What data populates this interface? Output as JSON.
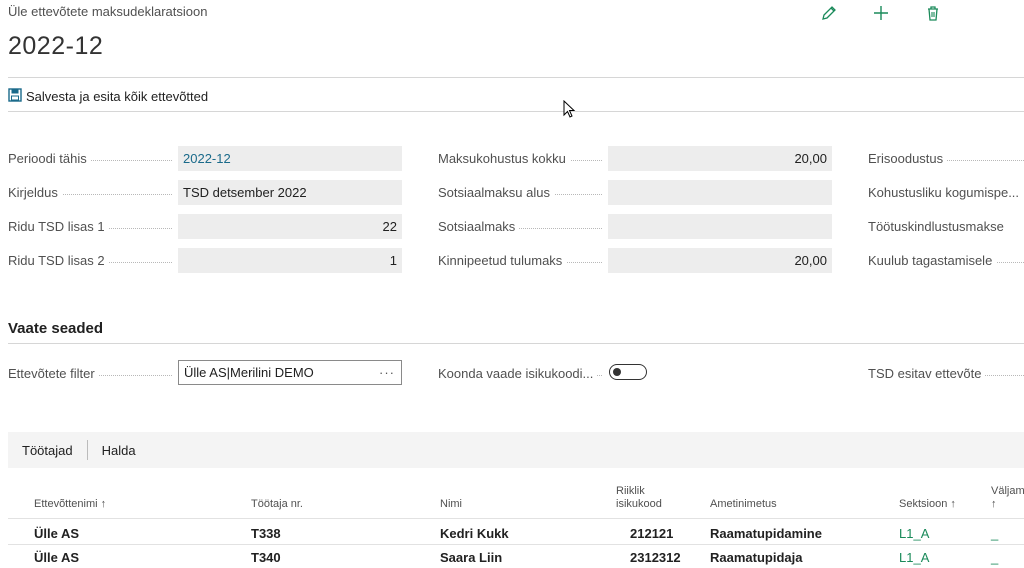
{
  "header": {
    "breadcrumb": "Üle ettevõtete maksudeklaratsioon",
    "title": "2022-12",
    "actions": [
      "edit-icon",
      "add-icon",
      "delete-icon"
    ]
  },
  "action_bar": {
    "save_label": "Salvesta ja esita kõik ettevõtted"
  },
  "fields": {
    "perioodi_tahis": {
      "label": "Perioodi tähis",
      "value": "2022-12"
    },
    "kirjeldus": {
      "label": "Kirjeldus",
      "value": "TSD detsember 2022"
    },
    "ridu_lisa1": {
      "label": "Ridu TSD lisas 1",
      "value": "22"
    },
    "ridu_lisa2": {
      "label": "Ridu TSD lisas 2",
      "value": "1"
    },
    "maksukohustus": {
      "label": "Maksukohustus kokku",
      "value": "20,00"
    },
    "sotsiaalmaksu_alus": {
      "label": "Sotsiaalmaksu alus",
      "value": ""
    },
    "sotsiaalmaks": {
      "label": "Sotsiaalmaks",
      "value": ""
    },
    "kinnipeetud": {
      "label": "Kinnipeetud tulumaks",
      "value": "20,00"
    },
    "erisoodustus": {
      "label": "Erisoodustus"
    },
    "kohustusliku": {
      "label": "Kohustusliku kogumispe..."
    },
    "tootuskindlustus": {
      "label": "Töötuskindlustusmakse"
    },
    "kuulub": {
      "label": "Kuulub tagastamisele"
    }
  },
  "view_settings": {
    "title": "Vaate seaded",
    "company_filter_label": "Ettevõtete filter",
    "company_filter_value": "Ülle AS|Merilini DEMO",
    "more_glyph": "···",
    "consolidate_label": "Koonda vaade isikukoodi...",
    "consolidate_on": false,
    "tsd_company_label": "TSD esitav ettevõte"
  },
  "grid": {
    "tabs": [
      "Töötajad",
      "Halda"
    ],
    "columns": {
      "company": "Ettevõttenimi ↑",
      "emp_no": "Töötaja nr.",
      "name": "Nimi",
      "id_code_1": "Riiklik",
      "id_code_2": "isikukood",
      "job": "Ametinimetus",
      "section": "Sektsioon ↑",
      "out_1": "Väljama",
      "out_2": "↑"
    },
    "rows": [
      {
        "company": "Ülle AS",
        "emp_no": "T338",
        "name": "Kedri Kukk",
        "id_code": "212121",
        "job": "Raamatupidamine",
        "section": "L1_A",
        "out": "_"
      },
      {
        "company": "Ülle AS",
        "emp_no": "T340",
        "name": "Saara Liin",
        "id_code": "2312312",
        "job": "Raamatupidaja",
        "section": "L1_A",
        "out": "_"
      }
    ]
  },
  "colors": {
    "accent": "#1a8a5a",
    "link": "#1a6a8a"
  }
}
